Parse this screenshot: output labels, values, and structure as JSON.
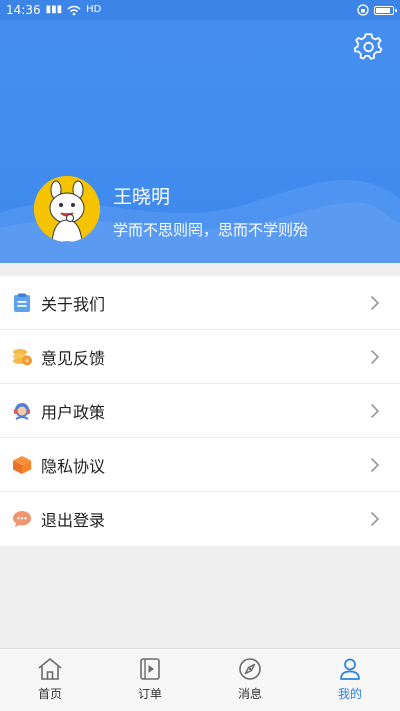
{
  "status_bar": {
    "time": "14:36",
    "network_label": "HD"
  },
  "profile": {
    "name": "王晓明",
    "motto": "学而不思则罔，思而不学则殆"
  },
  "menu": {
    "items": [
      {
        "label": "关于我们",
        "icon": "clipboard-icon"
      },
      {
        "label": "意见反馈",
        "icon": "coins-icon"
      },
      {
        "label": "用户政策",
        "icon": "headset-icon"
      },
      {
        "label": "隐私协议",
        "icon": "box-icon"
      },
      {
        "label": "退出登录",
        "icon": "chat-bubble-icon"
      }
    ]
  },
  "tab_bar": {
    "tabs": [
      {
        "label": "首页",
        "icon": "home-icon"
      },
      {
        "label": "订单",
        "icon": "play-document-icon"
      },
      {
        "label": "消息",
        "icon": "compass-icon"
      },
      {
        "label": "我的",
        "icon": "person-icon",
        "active": true
      }
    ]
  },
  "colors": {
    "header_blue": "#3e89ee",
    "active_tab": "#2a82e4",
    "avatar_yellow": "#f6c300"
  }
}
